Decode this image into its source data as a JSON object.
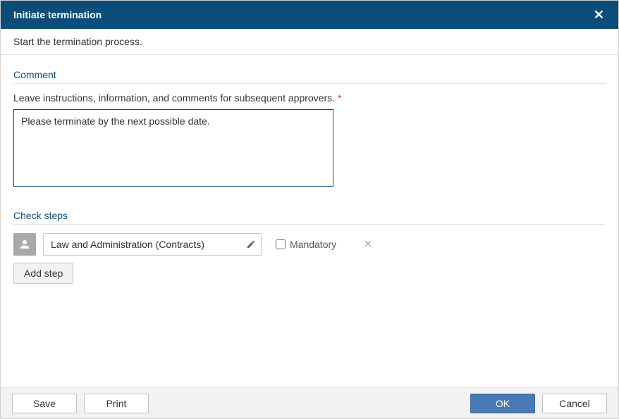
{
  "dialog": {
    "title": "Initiate termination",
    "subtitle": "Start the termination process."
  },
  "comment_section": {
    "heading": "Comment",
    "label": "Leave instructions, information, and comments for subsequent approvers.",
    "required_marker": "*",
    "value": "Please terminate by the next possible date."
  },
  "check_steps_section": {
    "heading": "Check steps",
    "steps": [
      {
        "value": "Law and Administration (Contracts)",
        "mandatory": false
      }
    ],
    "mandatory_label": "Mandatory",
    "add_step_label": "Add step"
  },
  "footer": {
    "save": "Save",
    "print": "Print",
    "ok": "OK",
    "cancel": "Cancel"
  }
}
